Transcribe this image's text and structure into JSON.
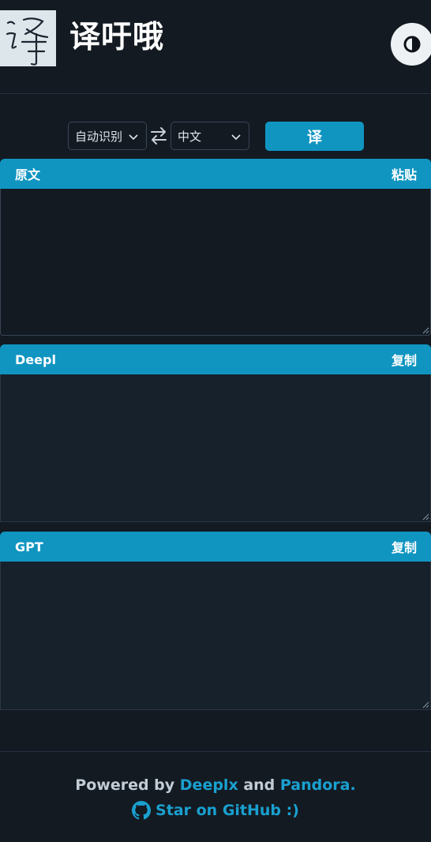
{
  "header": {
    "title": "译吁哦",
    "logo_glyph": "译",
    "theme_icon": "contrast-icon"
  },
  "toolbar": {
    "source_lang": "自动识别",
    "target_lang": "中文",
    "swap_icon": "swap-arrows-icon",
    "translate_label": "译"
  },
  "panels": {
    "source": {
      "title": "原文",
      "action": "粘贴",
      "value": ""
    },
    "deepl": {
      "title": "Deepl",
      "action": "复制",
      "value": ""
    },
    "gpt": {
      "title": "GPT",
      "action": "复制",
      "value": ""
    }
  },
  "footer": {
    "powered_prefix": "Powered by ",
    "deeplx_link": "Deeplx",
    "and_text": " and ",
    "pandora_link": "Pandora.",
    "github_text": "Star on GitHub :)",
    "github_icon": "github-icon"
  },
  "colors": {
    "background": "#131a22",
    "accent": "#1095c1",
    "link": "#1aa0d0"
  }
}
